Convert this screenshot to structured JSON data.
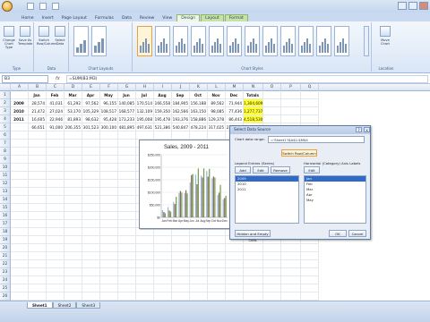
{
  "app": {
    "tabs": [
      "Home",
      "Insert",
      "Page Layout",
      "Formulas",
      "Data",
      "Review",
      "View",
      "Design",
      "Layout",
      "Format"
    ],
    "active_tab": "Design",
    "ribbon_groups": [
      "Type",
      "Data",
      "Chart Layouts",
      "Chart Styles",
      "Location"
    ],
    "ribbon_buttons": [
      {
        "label": "Change Chart Type",
        "icon": "chart-type-icon"
      },
      {
        "label": "Save As Template",
        "icon": "template-icon"
      },
      {
        "label": "Switch Row/Column",
        "icon": "switch-icon"
      },
      {
        "label": "Select Data",
        "icon": "select-data-icon"
      },
      {
        "label": "Move Chart",
        "icon": "move-chart-icon"
      }
    ]
  },
  "formula_bar": {
    "name_box": "B3",
    "fx": "fx",
    "content": "=SUM(B3:M3)"
  },
  "sheet": {
    "columns": [
      "",
      "A",
      "B",
      "C",
      "D",
      "E",
      "F",
      "G",
      "H",
      "I",
      "J",
      "K",
      "L",
      "M",
      "N",
      "O",
      "P",
      "Q"
    ],
    "header_row": [
      "",
      "Jan",
      "Feb",
      "Mar",
      "Apr",
      "May",
      "Jun",
      "Jul",
      "Aug",
      "Sep",
      "Oct",
      "Nov",
      "Dec",
      "Totals"
    ],
    "rows": [
      {
        "n": "1",
        "cells": [
          "",
          "Jan",
          "Feb",
          "Mar",
          "Apr",
          "May",
          "Jun",
          "Jul",
          "Aug",
          "Sep",
          "Oct",
          "Nov",
          "Dec",
          "Totals"
        ]
      },
      {
        "n": "2",
        "cells": [
          "2009",
          "28,574",
          "41,031",
          "61,292",
          "97,562",
          "96,155",
          "140,085",
          "170,514",
          "166,558",
          "184,905",
          "156,188",
          "89,562",
          "71,944",
          "1,304,609"
        ]
      },
      {
        "n": "3",
        "cells": [
          "2010",
          "21,472",
          "27,024",
          "53,170",
          "105,329",
          "108,517",
          "168,577",
          "132,109",
          "159,350",
          "162,566",
          "163,150",
          "98,085",
          "77,436",
          "1,277,737"
        ]
      },
      {
        "n": "4",
        "cells": [
          "2011",
          "16,605",
          "22,946",
          "81,893",
          "98,632",
          "95,428",
          "173,233",
          "195,008",
          "195,478",
          "193,376",
          "158,886",
          "129,378",
          "86,443",
          "4,518,530"
        ]
      },
      {
        "n": "5",
        "cells": [
          "",
          "66,651",
          "91,000",
          "206,355",
          "301,523",
          "300,100",
          "481,895",
          "497,631",
          "521,386",
          "540,847",
          "478,224",
          "317,025",
          "235,823",
          ""
        ]
      },
      {
        "n": "6",
        "cells": []
      },
      {
        "n": "7",
        "cells": []
      },
      {
        "n": "8",
        "cells": []
      },
      {
        "n": "9",
        "cells": []
      },
      {
        "n": "10",
        "cells": []
      },
      {
        "n": "11",
        "cells": []
      },
      {
        "n": "12",
        "cells": []
      },
      {
        "n": "13",
        "cells": []
      },
      {
        "n": "14",
        "cells": []
      },
      {
        "n": "15",
        "cells": []
      },
      {
        "n": "16",
        "cells": []
      },
      {
        "n": "17",
        "cells": []
      },
      {
        "n": "18",
        "cells": []
      },
      {
        "n": "19",
        "cells": []
      },
      {
        "n": "20",
        "cells": []
      },
      {
        "n": "21",
        "cells": []
      },
      {
        "n": "22",
        "cells": []
      },
      {
        "n": "23",
        "cells": []
      },
      {
        "n": "24",
        "cells": []
      },
      {
        "n": "25",
        "cells": []
      },
      {
        "n": "26",
        "cells": []
      }
    ]
  },
  "chart_data": {
    "type": "bar",
    "title": "Sales, 2009 - 2011",
    "categories": [
      "Jan",
      "Feb",
      "Mar",
      "Apr",
      "May",
      "Jun",
      "Jul",
      "Aug",
      "Sep",
      "Oct",
      "Nov",
      "Dec"
    ],
    "series": [
      {
        "values": [
          28574,
          41031,
          61292,
          97562,
          96155,
          140085,
          170514,
          166558,
          184905,
          156188,
          89562,
          71944
        ],
        "color": "#9bb7d9"
      },
      {
        "values": [
          21472,
          27024,
          53170,
          105329,
          108517,
          168577,
          132109,
          159350,
          162566,
          163150,
          98085,
          77436
        ],
        "color": "#8c6f4f"
      },
      {
        "values": [
          16605,
          22946,
          81893,
          98632,
          95428,
          173233,
          195008,
          195478,
          193376,
          158886,
          129378,
          86443
        ],
        "color": "#78a05a"
      }
    ],
    "y_ticks": [
      "$250,000",
      "$200,000",
      "$150,000",
      "$100,000",
      "$50,000",
      "$0"
    ],
    "ylim": [
      0,
      250000
    ]
  },
  "dialog": {
    "title": "Select Data Source",
    "range_label": "Chart data range:",
    "range_value": "='Sheet1'!$A$1:$M$4",
    "switch_label": "Switch Row/Column",
    "legend_label": "Legend Entries (Series)",
    "axis_label": "Horizontal (Category) Axis Labels",
    "add": "Add",
    "edit": "Edit",
    "remove": "Remove",
    "edit2": "Edit",
    "series_items": [
      "2009",
      "2010",
      "2011"
    ],
    "axis_items": [
      "Jan",
      "Feb",
      "Mar",
      "Apr",
      "May"
    ],
    "hidden_cells": "Hidden and Empty Cells",
    "ok": "OK",
    "cancel": "Cancel",
    "help": "?",
    "close": "x"
  },
  "sheets": [
    "Sheet1",
    "Sheet2",
    "Sheet3"
  ]
}
